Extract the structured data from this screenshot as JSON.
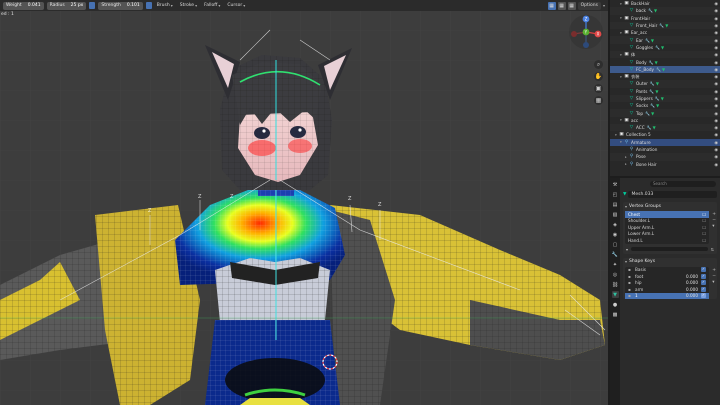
{
  "header": {
    "weight_label": "Weight",
    "weight_value": "0.041",
    "radius_label": "Radius",
    "radius_value": "25 px",
    "strength_label": "Strength",
    "strength_value": "0.101",
    "brush_label": "Brush",
    "stroke_label": "Stroke",
    "falloff_label": "Falloff",
    "cursor_label": "Cursor",
    "options_label": "Options"
  },
  "viewport": {
    "sublabel": "ed : 1",
    "gizmo": {
      "x": "X",
      "y": "Y",
      "z": "Z"
    }
  },
  "outliner": {
    "rows": [
      {
        "indent": 2,
        "icon": "collection",
        "label": "BackHair",
        "arrow": "▾"
      },
      {
        "indent": 3,
        "icon": "mesh",
        "label": "back",
        "mods": true
      },
      {
        "indent": 2,
        "icon": "collection",
        "label": "FrontHair",
        "arrow": "▾"
      },
      {
        "indent": 3,
        "icon": "mesh",
        "label": "Front_Hair",
        "mods": true
      },
      {
        "indent": 2,
        "icon": "collection",
        "label": "Ear_acc",
        "arrow": "▾"
      },
      {
        "indent": 3,
        "icon": "mesh",
        "label": "Ear",
        "mods": true
      },
      {
        "indent": 3,
        "icon": "mesh",
        "label": "Goggles",
        "mods": true
      },
      {
        "indent": 2,
        "icon": "collection",
        "label": "体",
        "arrow": "▾"
      },
      {
        "indent": 3,
        "icon": "mesh",
        "label": "Body",
        "mods": true
      },
      {
        "indent": 3,
        "icon": "mesh",
        "label": "FC_Body",
        "mods": true,
        "state": "active"
      },
      {
        "indent": 2,
        "icon": "collection",
        "label": "衣装",
        "arrow": "▾"
      },
      {
        "indent": 3,
        "icon": "mesh",
        "label": "Outer",
        "mods": true
      },
      {
        "indent": 3,
        "icon": "mesh",
        "label": "Pants",
        "mods": true
      },
      {
        "indent": 3,
        "icon": "mesh",
        "label": "Slippers",
        "mods": true
      },
      {
        "indent": 3,
        "icon": "mesh",
        "label": "Socks",
        "mods": true
      },
      {
        "indent": 3,
        "icon": "mesh",
        "label": "Top",
        "mods": true
      },
      {
        "indent": 2,
        "icon": "collection",
        "label": "acc",
        "arrow": "▾"
      },
      {
        "indent": 3,
        "icon": "mesh",
        "label": "ACC",
        "mods": true
      },
      {
        "indent": 1,
        "icon": "collection",
        "label": "Collection 5",
        "arrow": "▾"
      },
      {
        "indent": 2,
        "icon": "armature",
        "label": "Armature",
        "arrow": "▾",
        "state": "sel"
      },
      {
        "indent": 3,
        "icon": "armature",
        "label": "Animation",
        "arrow": ""
      },
      {
        "indent": 3,
        "icon": "armature",
        "label": "Pose",
        "arrow": "▸"
      },
      {
        "indent": 3,
        "icon": "armature",
        "label": "Bone Hair",
        "arrow": "▸"
      }
    ]
  },
  "properties": {
    "search_placeholder": "Search",
    "object_name": "Mesh.033",
    "vertex_groups": {
      "title": "Vertex Groups",
      "items": [
        "Chest",
        "Shoulder.L",
        "Upper Arm.L",
        "Lower Arm.L",
        "Hand.L"
      ],
      "selected_index": 0
    },
    "shape_keys": {
      "title": "Shape Keys",
      "items": [
        {
          "name": "Basis",
          "value": ""
        },
        {
          "name": "foot",
          "value": "0.000"
        },
        {
          "name": "hip",
          "value": "0.000"
        },
        {
          "name": "arm",
          "value": "0.000"
        },
        {
          "name": "1",
          "value": "0.000"
        }
      ],
      "selected_index": 4
    }
  },
  "colors": {
    "viewport_bg": "#3d3d3d",
    "accent": "#4772b3",
    "weight_hot": "#ff2a00",
    "weight_cold": "#0a2fa0",
    "wire_yellow": "#e8d040"
  }
}
